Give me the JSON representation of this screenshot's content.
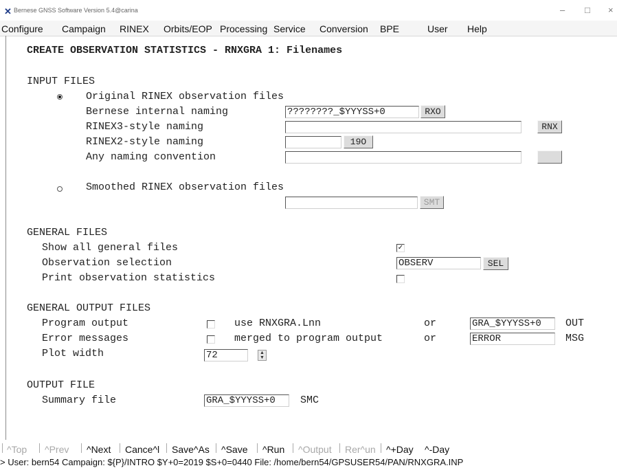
{
  "window": {
    "title": "Bernese GNSS Software Version 5.4@carina",
    "controls": [
      "–",
      "□",
      "×"
    ]
  },
  "menu": [
    "Configure",
    "Campaign",
    "RINEX",
    "Orbits/EOP",
    "Processing",
    "Service",
    "Conversion",
    "BPE",
    "User",
    "Help"
  ],
  "panel": {
    "heading": "CREATE OBSERVATION STATISTICS - RNXGRA 1: Filenames",
    "input_files": {
      "title": "INPUT FILES",
      "original_label": "Original RINEX observation files",
      "original_selected": true,
      "bernese_label": "Bernese internal naming",
      "bernese_value": "????????_$YYYSS+0",
      "bernese_btn": "RXO",
      "rinex3_label": "RINEX3-style naming",
      "rinex3_value": "",
      "rinex3_btn": "RNX",
      "rinex2_label": "RINEX2-style naming",
      "rinex2_value": "",
      "rinex2_btn": "19O",
      "any_label": "Any naming convention",
      "any_value": "",
      "any_btn": "",
      "smoothed_label": "Smoothed RINEX observation files",
      "smoothed_selected": false,
      "smoothed_value": "",
      "smoothed_btn": "SMT"
    },
    "general_files": {
      "title": "GENERAL FILES",
      "show_all_label": "Show all general files",
      "show_all_checked": true,
      "obs_sel_label": "Observation selection",
      "obs_sel_value": "OBSERV",
      "obs_sel_btn": "SEL",
      "print_stats_label": "Print observation statistics",
      "print_stats_checked": false
    },
    "general_output": {
      "title": "GENERAL OUTPUT FILES",
      "program_output_label": "Program output",
      "program_output_checked": false,
      "program_output_option": "use RNXGRA.Lnn",
      "program_output_or": "or",
      "program_output_value": "GRA_$YYYSS+0",
      "program_output_ext": "OUT",
      "error_label": "Error messages",
      "error_checked": false,
      "error_option": "merged to program output",
      "error_or": "or",
      "error_value": "ERROR",
      "error_ext": "MSG",
      "plot_width_label": "Plot width",
      "plot_width_value": "72"
    },
    "output_file": {
      "title": "OUTPUT FILE",
      "summary_label": "Summary file",
      "summary_value": "GRA_$YYYSS+0",
      "summary_ext": "SMC"
    }
  },
  "bottom_buttons": [
    {
      "label": "^Top",
      "enabled": false
    },
    {
      "label": "^Prev",
      "enabled": false
    },
    {
      "label": "^Next",
      "enabled": true
    },
    {
      "label": "Cance^l",
      "enabled": true
    },
    {
      "label": "Save^As",
      "enabled": true
    },
    {
      "label": "^Save",
      "enabled": true
    },
    {
      "label": "^Run",
      "enabled": true
    },
    {
      "label": "^Output",
      "enabled": false
    },
    {
      "label": "Rer^un",
      "enabled": false
    },
    {
      "label": "^+Day",
      "enabled": true
    },
    {
      "label": "^-Day",
      "enabled": true
    }
  ],
  "status": "> User: bern54  Campaign: ${P}/INTRO  $Y+0=2019  $S+0=0440  File: /home/bern54/GPSUSER54/PAN/RNXGRA.INP"
}
